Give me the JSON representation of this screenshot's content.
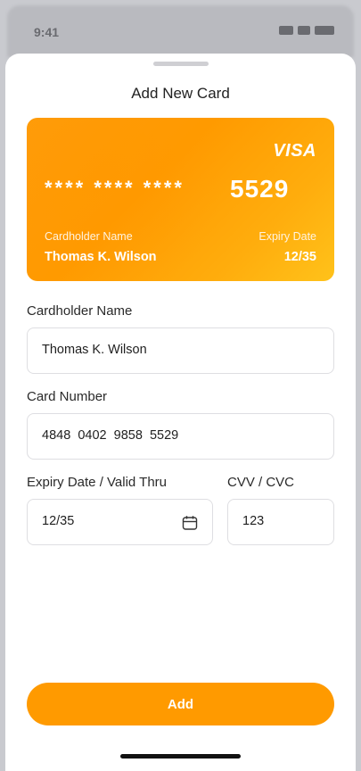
{
  "status_bar": {
    "time": "9:41"
  },
  "sheet": {
    "title": "Add New Card"
  },
  "card_preview": {
    "brand": "VISA",
    "masked_digits": "**** **** ****",
    "last4": "5529",
    "holder_label": "Cardholder Name",
    "holder_value": "Thomas K. Wilson",
    "expiry_label": "Expiry Date",
    "expiry_value": "12/35"
  },
  "form": {
    "cardholder": {
      "label": "Cardholder Name",
      "value": "Thomas K. Wilson"
    },
    "card_number": {
      "label": "Card Number",
      "value": "4848  0402  9858  5529"
    },
    "expiry": {
      "label": "Expiry Date / Valid Thru",
      "value": "12/35"
    },
    "cvv": {
      "label": "CVV / CVC",
      "value": "123"
    }
  },
  "actions": {
    "add_label": "Add"
  },
  "colors": {
    "accent": "#ff9a00",
    "card_gradient_end": "#ffc21a"
  }
}
